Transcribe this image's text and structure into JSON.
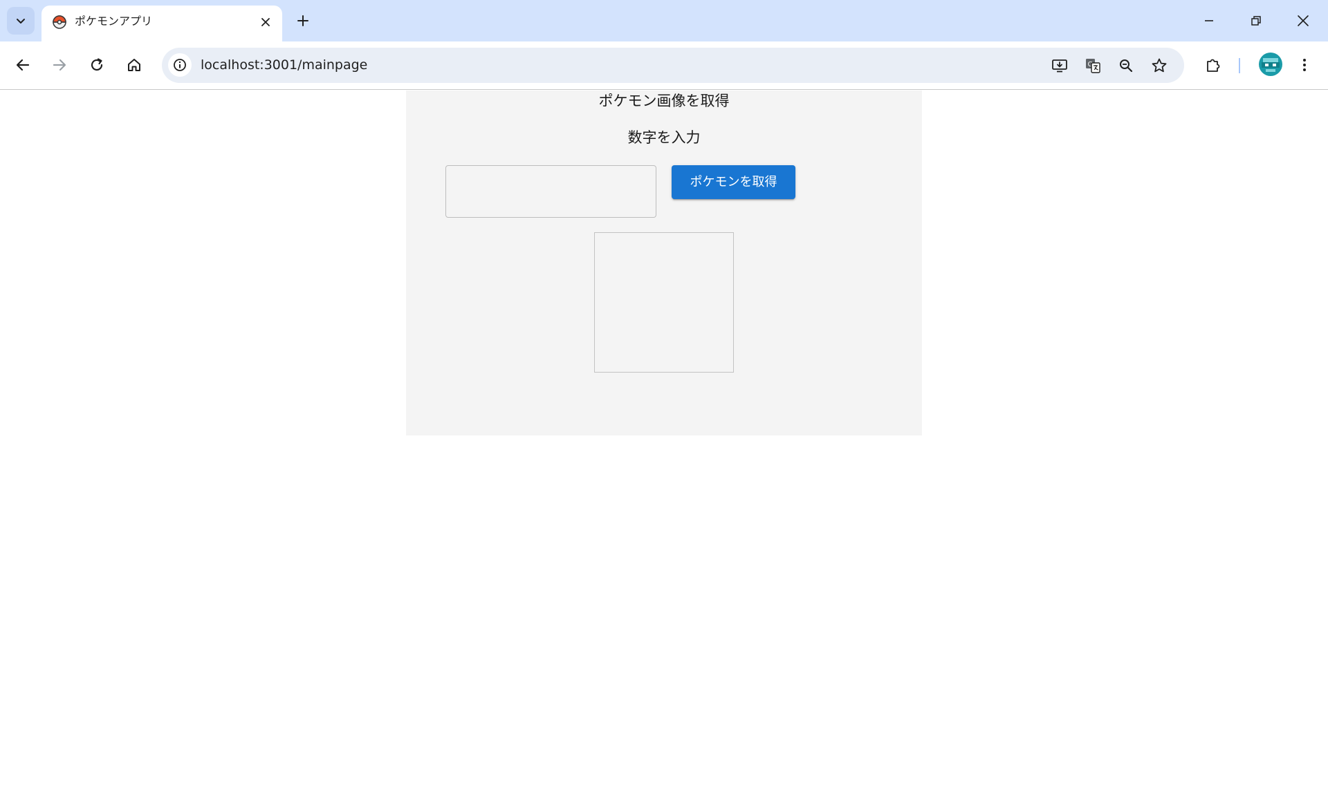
{
  "browser": {
    "tab": {
      "title": "ポケモンアプリ",
      "favicon": "pokeball-icon"
    },
    "address_bar": {
      "url": "localhost:3001/mainpage"
    },
    "colors": {
      "tabstrip": "#d3e3fd",
      "omnibox": "#e9eef6"
    }
  },
  "page": {
    "title": "ポケモン画像を取得",
    "input_label": "数字を入力",
    "number_input": {
      "value": "",
      "placeholder": ""
    },
    "fetch_button_label": "ポケモンを取得",
    "colors": {
      "panel_background": "#f4f4f4",
      "button_primary": "#1976d2"
    }
  }
}
